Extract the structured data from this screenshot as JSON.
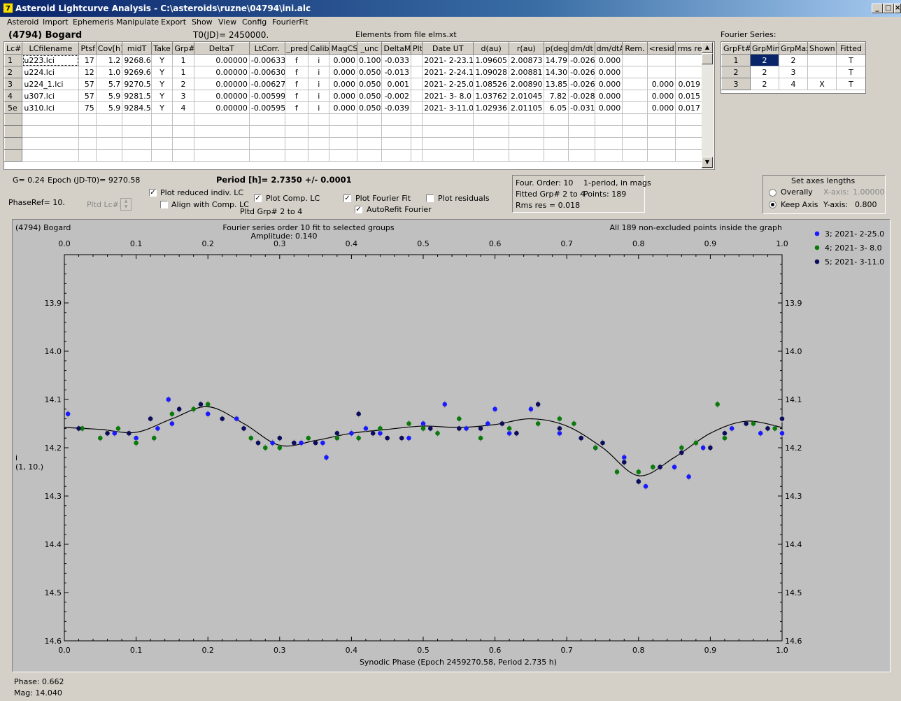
{
  "window": {
    "title": "Asteroid Lightcurve Analysis - C:\\asteroids\\ruzne\\04794\\ini.alc",
    "icon": "app-icon"
  },
  "menu": [
    "Asteroid",
    "Import",
    "Ephemeris",
    "Manipulate",
    "Export",
    "Show",
    "View",
    "Config",
    "FourierFit"
  ],
  "header": {
    "asteroid": "(4794) Bogard",
    "t0": "T0(JD)= 2450000.",
    "elements": "Elements from file elms.xt",
    "fourier_label": "Fourier Series:"
  },
  "lc_table": {
    "columns": [
      "Lc#",
      "LCfilename",
      "Ptsf",
      "Cov[h]",
      "midT",
      "Take",
      "Grp#",
      "DeltaT",
      "LtCorr.",
      "_pred.",
      "Calib.",
      "MagCS",
      "_unc",
      "DeltaM",
      "Plt",
      "Date UT",
      "d(au)",
      "r(au)",
      "p(deg)",
      "dm/dt",
      "dm/dtA",
      "Rem.",
      "<resid>",
      "rms res"
    ],
    "rows": [
      [
        "1",
        "u223.lci",
        "17",
        "1.2",
        "9268.6",
        "Y",
        "1",
        "0.00000",
        "-0.00633",
        "f",
        "i",
        "0.000",
        "0.100",
        "-0.033",
        "",
        "2021- 2-23.1",
        "1.09605",
        "2.00873",
        "14.79",
        "-0.026",
        "0.000",
        "",
        "",
        ""
      ],
      [
        "2",
        "u224.lci",
        "12",
        "1.0",
        "9269.6",
        "Y",
        "1",
        "0.00000",
        "-0.00630",
        "f",
        "i",
        "0.000",
        "0.050",
        "-0.013",
        "",
        "2021- 2-24.1",
        "1.09028",
        "2.00881",
        "14.30",
        "-0.026",
        "0.000",
        "",
        "",
        ""
      ],
      [
        "3",
        "u224_1.lci",
        "57",
        "5.7",
        "9270.5",
        "Y",
        "2",
        "0.00000",
        "-0.00627",
        "f",
        "i",
        "0.000",
        "0.050",
        "0.001",
        "",
        "2021- 2-25.0",
        "1.08526",
        "2.00890",
        "13.85",
        "-0.026",
        "0.000",
        "",
        "0.000",
        "0.019"
      ],
      [
        "4",
        "u307.lci",
        "57",
        "5.9",
        "9281.5",
        "Y",
        "3",
        "0.00000",
        "-0.00599",
        "f",
        "i",
        "0.000",
        "0.050",
        "-0.002",
        "",
        "2021- 3- 8.0",
        "1.03762",
        "2.01045",
        "7.82",
        "-0.028",
        "0.000",
        "",
        "0.000",
        "0.015"
      ],
      [
        "5e",
        "u310.lci",
        "75",
        "5.9",
        "9284.5",
        "Y",
        "4",
        "0.00000",
        "-0.00595",
        "f",
        "i",
        "0.000",
        "0.050",
        "-0.039",
        "",
        "2021- 3-11.0",
        "1.02936",
        "2.01105",
        "6.05",
        "-0.031",
        "0.000",
        "",
        "0.000",
        "0.017"
      ]
    ]
  },
  "fourier_table": {
    "columns": [
      "GrpFt#",
      "GrpMin",
      "GrpMax",
      "Shown",
      "Fitted"
    ],
    "rows": [
      [
        "1",
        "2",
        "2",
        "",
        "T"
      ],
      [
        "2",
        "2",
        "3",
        "",
        "T"
      ],
      [
        "3",
        "2",
        "4",
        "X",
        "T"
      ]
    ]
  },
  "controls": {
    "g": "G= 0.24",
    "epoch": "Epoch (JD-T0)= 9270.58",
    "period": "Period [h]= 2.7350 +/- 0.0001",
    "phaseref": "PhaseRef= 10.",
    "pltd_lc": "Pltd Lc#:",
    "plot_reduced": "Plot reduced indiv. LC",
    "align_comp": "Align with Comp. LC",
    "plot_comp": "Plot Comp. LC",
    "pltd_grp": "Pltd Grp#  2   to   4",
    "plot_fourier": "Plot Fourier Fit",
    "autorefit": "AutoRefit Fourier",
    "plot_residuals": "Plot residuals",
    "check_x": "✓"
  },
  "fourier_info": {
    "order": "Four. Order: 10",
    "period_mode": "1-period, in mags",
    "fitted_grp": "Fitted Grp# 2 to 4",
    "points": "Points: 189",
    "rms": "Rms res      = 0.018"
  },
  "axes_box": {
    "title": "Set axes lengths",
    "overally": "Overally",
    "keep_axis": "Keep Axis",
    "xaxis_label": "X-axis:",
    "xaxis_val": "1.00000",
    "yaxis_label": "Y-axis:",
    "yaxis_val": "0.800"
  },
  "chart_data": {
    "type": "scatter",
    "title": "Fourier series order 10 fit to selected groups",
    "subtitle": "Amplitude: 0.140",
    "top_left": "(4794) Bogard",
    "top_right": "All 189 non-excluded points inside the graph",
    "xlabel": "Synodic Phase (Epoch 2459270.58, Period 2.735 h)",
    "ylabel": "i",
    "ylabel2": "(1, 10.)",
    "xlim": [
      0.0,
      1.0
    ],
    "ylim": [
      13.8,
      14.6
    ],
    "y_inverted": true,
    "xticks": [
      "0.0",
      "0.1",
      "0.2",
      "0.3",
      "0.4",
      "0.5",
      "0.6",
      "0.7",
      "0.8",
      "0.9",
      "1.0"
    ],
    "yticks": [
      "13.9",
      "14.0",
      "14.1",
      "14.2",
      "14.3",
      "14.4",
      "14.5",
      "14.6"
    ],
    "colors": {
      "s3": "#1a1aff",
      "s4": "#0a7a0a",
      "s5": "#0d0d5c",
      "fit": "#000000",
      "bg": "#c0c0c0"
    },
    "series": [
      {
        "name": "3; 2021- 2-25.0",
        "points": [
          [
            0.005,
            14.13
          ],
          [
            0.07,
            14.17
          ],
          [
            0.1,
            14.18
          ],
          [
            0.13,
            14.16
          ],
          [
            0.145,
            14.1
          ],
          [
            0.15,
            14.15
          ],
          [
            0.2,
            14.13
          ],
          [
            0.24,
            14.14
          ],
          [
            0.29,
            14.19
          ],
          [
            0.33,
            14.19
          ],
          [
            0.36,
            14.19
          ],
          [
            0.365,
            14.22
          ],
          [
            0.4,
            14.17
          ],
          [
            0.42,
            14.16
          ],
          [
            0.44,
            14.17
          ],
          [
            0.48,
            14.18
          ],
          [
            0.5,
            14.15
          ],
          [
            0.53,
            14.11
          ],
          [
            0.56,
            14.16
          ],
          [
            0.59,
            14.15
          ],
          [
            0.6,
            14.12
          ],
          [
            0.62,
            14.17
          ],
          [
            0.65,
            14.12
          ],
          [
            0.69,
            14.17
          ],
          [
            0.72,
            14.18
          ],
          [
            0.74,
            14.2
          ],
          [
            0.78,
            14.22
          ],
          [
            0.8,
            14.27
          ],
          [
            0.81,
            14.28
          ],
          [
            0.85,
            14.24
          ],
          [
            0.87,
            14.26
          ],
          [
            0.89,
            14.2
          ],
          [
            0.93,
            14.16
          ],
          [
            0.97,
            14.17
          ],
          [
            1.0,
            14.17
          ]
        ]
      },
      {
        "name": "4; 2021- 3- 8.0",
        "points": [
          [
            0.025,
            14.16
          ],
          [
            0.05,
            14.18
          ],
          [
            0.075,
            14.16
          ],
          [
            0.1,
            14.19
          ],
          [
            0.125,
            14.18
          ],
          [
            0.15,
            14.13
          ],
          [
            0.18,
            14.12
          ],
          [
            0.2,
            14.11
          ],
          [
            0.26,
            14.18
          ],
          [
            0.28,
            14.2
          ],
          [
            0.3,
            14.2
          ],
          [
            0.34,
            14.18
          ],
          [
            0.38,
            14.18
          ],
          [
            0.41,
            14.18
          ],
          [
            0.44,
            14.16
          ],
          [
            0.48,
            14.15
          ],
          [
            0.5,
            14.16
          ],
          [
            0.52,
            14.17
          ],
          [
            0.55,
            14.14
          ],
          [
            0.58,
            14.18
          ],
          [
            0.62,
            14.16
          ],
          [
            0.66,
            14.15
          ],
          [
            0.69,
            14.14
          ],
          [
            0.71,
            14.15
          ],
          [
            0.74,
            14.2
          ],
          [
            0.77,
            14.25
          ],
          [
            0.8,
            14.25
          ],
          [
            0.82,
            14.24
          ],
          [
            0.86,
            14.2
          ],
          [
            0.88,
            14.19
          ],
          [
            0.91,
            14.11
          ],
          [
            0.92,
            14.18
          ],
          [
            0.96,
            14.15
          ],
          [
            0.99,
            14.16
          ]
        ]
      },
      {
        "name": "5; 2021- 3-11.0",
        "points": [
          [
            0.02,
            14.16
          ],
          [
            0.06,
            14.17
          ],
          [
            0.09,
            14.17
          ],
          [
            0.12,
            14.14
          ],
          [
            0.16,
            14.12
          ],
          [
            0.19,
            14.11
          ],
          [
            0.22,
            14.14
          ],
          [
            0.25,
            14.16
          ],
          [
            0.27,
            14.19
          ],
          [
            0.3,
            14.18
          ],
          [
            0.32,
            14.19
          ],
          [
            0.35,
            14.19
          ],
          [
            0.38,
            14.17
          ],
          [
            0.41,
            14.13
          ],
          [
            0.43,
            14.17
          ],
          [
            0.45,
            14.18
          ],
          [
            0.47,
            14.18
          ],
          [
            0.51,
            14.16
          ],
          [
            0.55,
            14.16
          ],
          [
            0.58,
            14.16
          ],
          [
            0.61,
            14.15
          ],
          [
            0.63,
            14.17
          ],
          [
            0.66,
            14.11
          ],
          [
            0.69,
            14.16
          ],
          [
            0.72,
            14.18
          ],
          [
            0.75,
            14.19
          ],
          [
            0.78,
            14.23
          ],
          [
            0.8,
            14.27
          ],
          [
            0.83,
            14.24
          ],
          [
            0.86,
            14.21
          ],
          [
            0.9,
            14.2
          ],
          [
            0.92,
            14.17
          ],
          [
            0.95,
            14.15
          ],
          [
            0.98,
            14.16
          ],
          [
            1.0,
            14.14
          ]
        ]
      }
    ],
    "fit_curve": [
      [
        0.0,
        14.158
      ],
      [
        0.05,
        14.162
      ],
      [
        0.1,
        14.168
      ],
      [
        0.15,
        14.14
      ],
      [
        0.2,
        14.115
      ],
      [
        0.25,
        14.15
      ],
      [
        0.3,
        14.195
      ],
      [
        0.35,
        14.185
      ],
      [
        0.4,
        14.17
      ],
      [
        0.45,
        14.162
      ],
      [
        0.5,
        14.155
      ],
      [
        0.55,
        14.158
      ],
      [
        0.6,
        14.152
      ],
      [
        0.65,
        14.14
      ],
      [
        0.7,
        14.155
      ],
      [
        0.75,
        14.2
      ],
      [
        0.8,
        14.258
      ],
      [
        0.85,
        14.22
      ],
      [
        0.9,
        14.17
      ],
      [
        0.95,
        14.145
      ],
      [
        1.0,
        14.158
      ]
    ]
  },
  "status": {
    "phase": "Phase:  0.662",
    "mag": "Mag:   14.040"
  }
}
